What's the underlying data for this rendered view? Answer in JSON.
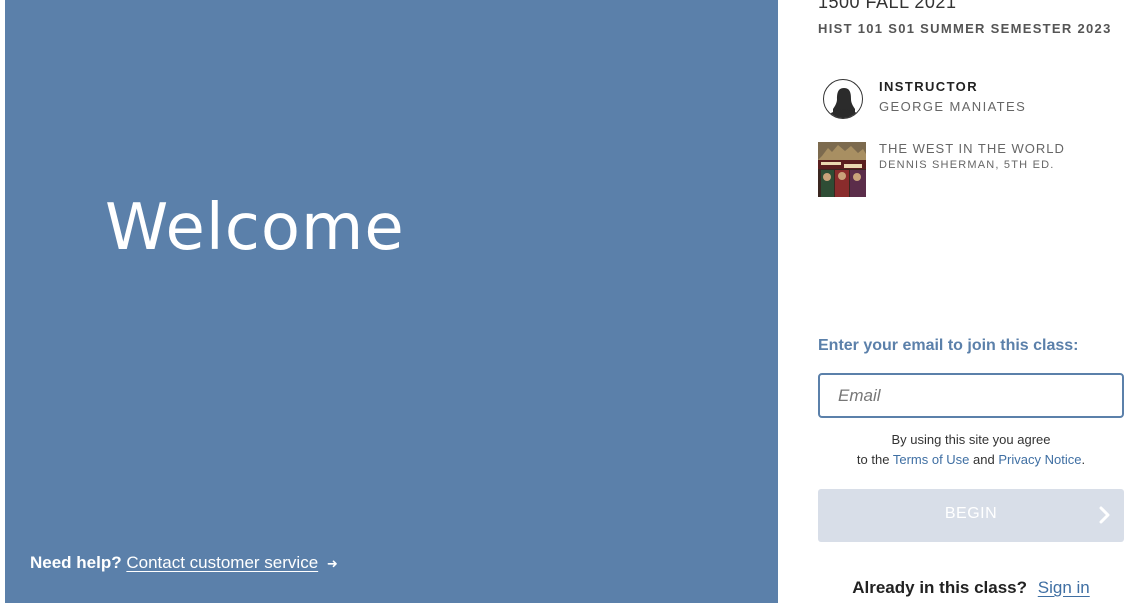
{
  "welcome_panel": {
    "heading": "Welcome",
    "help_prompt": "Need help?",
    "help_link": "Contact customer service",
    "help_arrow": "➜",
    "background_color": "#5b80aa"
  },
  "course": {
    "name": "1500 FALL 2021",
    "section": "HIST 101 S01 SUMMER SEMESTER 2023"
  },
  "instructor": {
    "label": "INSTRUCTOR",
    "name": "GEORGE MANIATES",
    "avatar_icon": "person-silhouette-icon"
  },
  "book": {
    "title": "THE WEST IN THE WORLD",
    "author": "DENNIS SHERMAN, 5TH ED."
  },
  "join_form": {
    "label": "Enter your email to join this class:",
    "email_placeholder": "Email",
    "email_value": "",
    "terms_prefix": "By using this site you agree",
    "terms_to_the": "to the",
    "terms_link": "Terms of Use",
    "terms_and": "and",
    "privacy_link": "Privacy Notice",
    "terms_period": ".",
    "begin_label": "BEGIN",
    "begin_icon": "chevron-right-icon",
    "accent_color": "#5b80aa",
    "begin_disabled_color": "#d8dee8"
  },
  "signin": {
    "prompt": "Already in this class?",
    "link": "Sign in"
  }
}
